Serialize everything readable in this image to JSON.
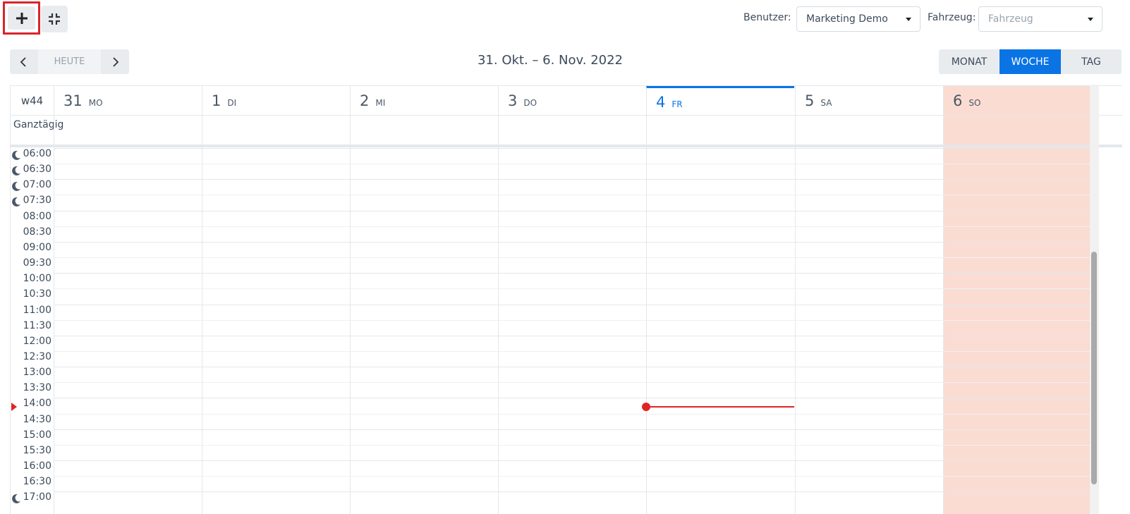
{
  "toolbar": {
    "add_icon": "plus-icon",
    "collapse_icon": "collapse-icon",
    "user_label": "Benutzer:",
    "user_value": "Marketing Demo",
    "vehicle_label": "Fahrzeug:",
    "vehicle_placeholder": "Fahrzeug"
  },
  "nav": {
    "prev_icon": "chevron-left-icon",
    "today_label": "HEUTE",
    "next_icon": "chevron-right-icon",
    "range_title": "31. Okt. – 6. Nov. 2022"
  },
  "views": {
    "month": "MONAT",
    "week": "WOCHE",
    "day": "TAG",
    "active": "WOCHE"
  },
  "calendar": {
    "week_label": "w44",
    "allday_label": "Ganztägig",
    "days": [
      {
        "num": "31",
        "name": "MO"
      },
      {
        "num": "1",
        "name": "DI"
      },
      {
        "num": "2",
        "name": "MI"
      },
      {
        "num": "3",
        "name": "DO"
      },
      {
        "num": "4",
        "name": "FR",
        "today": true
      },
      {
        "num": "5",
        "name": "SA"
      },
      {
        "num": "6",
        "name": "SO",
        "holiday": true
      }
    ],
    "times": [
      {
        "t": "06:00",
        "night": true
      },
      {
        "t": "06:30",
        "night": true
      },
      {
        "t": "07:00",
        "night": true
      },
      {
        "t": "07:30",
        "night": true
      },
      {
        "t": "08:00"
      },
      {
        "t": "08:30"
      },
      {
        "t": "09:00"
      },
      {
        "t": "09:30"
      },
      {
        "t": "10:00"
      },
      {
        "t": "10:30"
      },
      {
        "t": "11:00"
      },
      {
        "t": "11:30"
      },
      {
        "t": "12:00"
      },
      {
        "t": "12:30"
      },
      {
        "t": "13:00"
      },
      {
        "t": "13:30"
      },
      {
        "t": "14:00",
        "now": true
      },
      {
        "t": "14:30"
      },
      {
        "t": "15:00"
      },
      {
        "t": "15:30"
      },
      {
        "t": "16:00"
      },
      {
        "t": "16:30"
      },
      {
        "t": "17:00",
        "night": true
      }
    ],
    "colors": {
      "accent": "#0b74e5",
      "now_indicator": "#e02424",
      "holiday_bg": "#fadcd3"
    }
  }
}
